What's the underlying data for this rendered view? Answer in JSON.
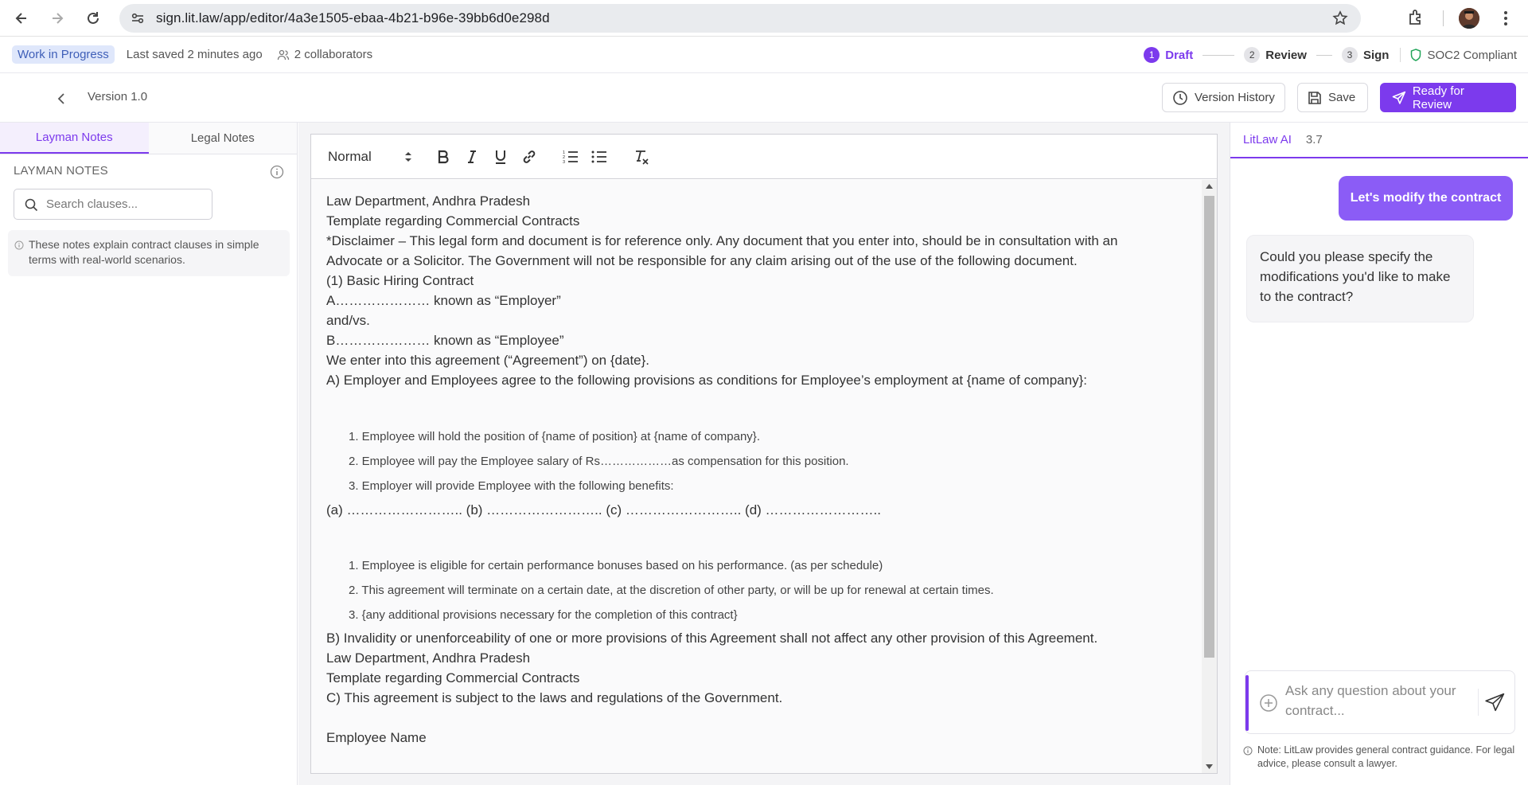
{
  "browser": {
    "url": "sign.lit.law/app/editor/4a3e1505-ebaa-4b21-b96e-39bb6d0e298d"
  },
  "status": {
    "badge": "Work in Progress",
    "last_saved": "Last saved 2 minutes ago",
    "collaborators": "2 collaborators",
    "steps": [
      {
        "num": "1",
        "label": "Draft",
        "active": true
      },
      {
        "num": "2",
        "label": "Review",
        "active": false
      },
      {
        "num": "3",
        "label": "Sign",
        "active": false
      }
    ],
    "compliance": "SOC2 Compliant"
  },
  "header": {
    "version": "Version 1.0",
    "version_history": "Version History",
    "save": "Save",
    "ready": "Ready for Review"
  },
  "left_panel": {
    "tabs": [
      "Layman Notes",
      "Legal Notes"
    ],
    "active_tab": 0,
    "title": "LAYMAN NOTES",
    "search_placeholder": "Search clauses...",
    "note": "These notes explain contract clauses in simple terms with real-world scenarios."
  },
  "editor": {
    "format": "Normal",
    "lines_top": [
      "Law Department, Andhra Pradesh",
      "Template regarding Commercial Contracts",
      "*Disclaimer – This legal form and document is for reference only. Any document that you enter into, should be in consultation with an",
      "Advocate or a Solicitor. The Government will not be responsible for any claim arising out of the use of the following document.",
      "(1) Basic Hiring Contract",
      "A………………… known as “Employer”",
      "and/vs.",
      "B………………… known as “Employee”",
      "We enter into this agreement (“Agreement”) on {date}.",
      "A) Employer and Employees agree to the following provisions as conditions for Employee’s employment at {name of company}:"
    ],
    "list1": [
      "1. Employee will hold the position of {name of position} at {name of company}.",
      "2. Employee will pay the Employee salary of Rs………………as compensation for this position.",
      "3. Employer will provide Employee with the following benefits:"
    ],
    "benefits_line": "(a) …………………….. (b) …………………….. (c) …………………….. (d) ……………………..",
    "list2": [
      "1. Employee is eligible for certain performance bonuses based on his performance. (as per schedule)",
      "2. This agreement will terminate on a certain date, at the discretion of other party, or will be up for renewal at certain times.",
      "3. {any additional provisions necessary for the completion of this contract}"
    ],
    "lines_bottom": [
      "B) Invalidity or unenforceability of one or more provisions of this Agreement shall not affect any other provision of this Agreement.",
      "Law Department, Andhra Pradesh",
      "Template regarding Commercial Contracts",
      "C) This agreement is subject to the laws and regulations of the Government."
    ],
    "last_line": "Employee Name"
  },
  "right_panel": {
    "title": "LitLaw AI",
    "version": "3.7",
    "user_message": "Let's modify the contract",
    "ai_message": "Could you please specify the modifications you'd like to make to the contract?",
    "input_placeholder": "Ask any question about your contract...",
    "disclaimer": "Note: LitLaw provides general contract guidance. For legal advice, please consult a lawyer."
  },
  "colors": {
    "accent": "#7c3aed",
    "user_bubble": "#8b5cf6",
    "badge_bg": "#dfe7fb",
    "compliance_icon": "#22a55a"
  }
}
